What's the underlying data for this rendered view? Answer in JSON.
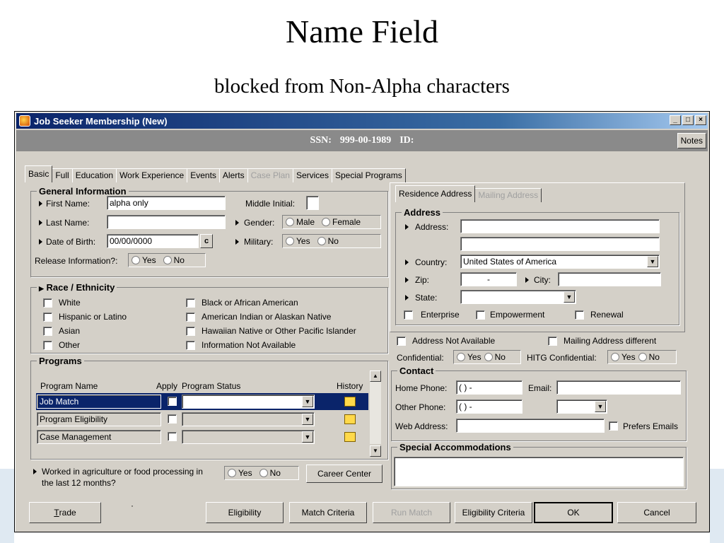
{
  "slide": {
    "title": "Name Field",
    "subtitle": "blocked from Non-Alpha characters"
  },
  "window": {
    "title": "Job Seeker Membership (New)",
    "ssn_label": "SSN:",
    "ssn_value": "999-00-1989",
    "id_label": "ID:",
    "notes": "Notes"
  },
  "tabs": [
    "Basic",
    "Full",
    "Education",
    "Work Experience",
    "Events",
    "Alerts",
    "Case Plan",
    "Services",
    "Special Programs"
  ],
  "general": {
    "legend": "General Information",
    "first_name_label": "First Name:",
    "first_name_value": "alpha only",
    "middle_label": "Middle Initial:",
    "last_name_label": "Last Name:",
    "gender_label": "Gender:",
    "male": "Male",
    "female": "Female",
    "dob_label": "Date of Birth:",
    "dob_value": "00/00/0000",
    "military_label": "Military:",
    "yes": "Yes",
    "no": "No",
    "release_label": "Release Information?:"
  },
  "race": {
    "legend": "Race / Ethnicity",
    "left": [
      "White",
      "Hispanic or Latino",
      "Asian",
      "Other"
    ],
    "right": [
      "Black or African American",
      "American Indian or Alaskan Native",
      "Hawaiian Native or Other Pacific Islander",
      "Information Not Available"
    ]
  },
  "programs": {
    "legend": "Programs",
    "col_name": "Program Name",
    "col_apply": "Apply",
    "col_status": "Program Status",
    "col_history": "History",
    "rows": [
      "Job Match",
      "Program Eligibility",
      "Case Management"
    ]
  },
  "agri": {
    "label1": "Worked in agriculture or food processing in",
    "label2": "the last 12 months?",
    "career_center": "Career Center"
  },
  "address": {
    "tab1": "Residence Address",
    "tab2": "Mailing Address",
    "legend": "Address",
    "address_label": "Address:",
    "country_label": "Country:",
    "country_value": "United States of America",
    "zip_label": "Zip:",
    "zip_value": "-",
    "city_label": "City:",
    "state_label": "State:",
    "enterprise": "Enterprise",
    "empowerment": "Empowerment",
    "renewal": "Renewal",
    "not_available": "Address Not Available",
    "mailing_diff": "Mailing Address different",
    "confidential_label": "Confidential:",
    "hitg_label": "HITG Confidential:"
  },
  "contact": {
    "legend": "Contact",
    "home_phone_label": "Home Phone:",
    "phone_value": "(  )  -",
    "email_label": "Email:",
    "other_phone_label": "Other  Phone:",
    "web_label": "Web Address:",
    "prefers_emails": "Prefers Emails"
  },
  "special": {
    "legend": "Special Accommodations"
  },
  "buttons": {
    "trade": "Trade",
    "eligibility": "Eligibility",
    "match_criteria": "Match Criteria",
    "run_match": "Run Match",
    "eligibility_criteria": "Eligibility Criteria",
    "ok": "OK",
    "cancel": "Cancel"
  }
}
